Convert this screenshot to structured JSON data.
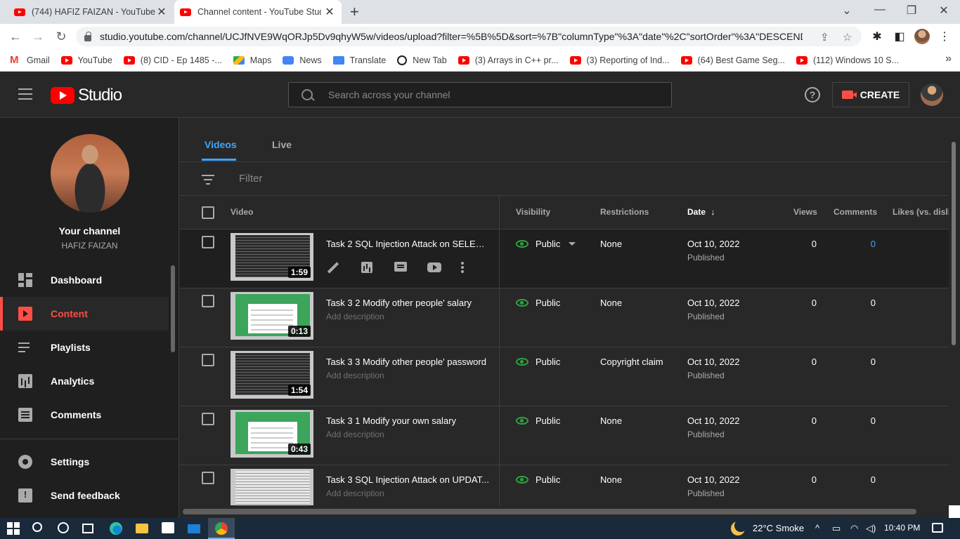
{
  "browser": {
    "tabs": [
      {
        "title": "(744) HAFIZ FAIZAN - YouTube"
      },
      {
        "title": "Channel content - YouTube Studio"
      }
    ],
    "url": "studio.youtube.com/channel/UCJfNVE9WqORJp5Dv9qhyW5w/videos/upload?filter=%5B%5D&sort=%7B\"columnType\"%3A\"date\"%2C\"sortOrder\"%3A\"DESCENDI...",
    "bookmarks": [
      {
        "label": "Gmail",
        "icon": "gmail-icon"
      },
      {
        "label": "YouTube",
        "icon": "youtube-icon"
      },
      {
        "label": "(8) CID - Ep 1485 -...",
        "icon": "youtube-icon"
      },
      {
        "label": "Maps",
        "icon": "maps-icon"
      },
      {
        "label": "News",
        "icon": "news-icon"
      },
      {
        "label": "Translate",
        "icon": "translate-icon"
      },
      {
        "label": "New Tab",
        "icon": "globe-icon"
      },
      {
        "label": "(3) Arrays in C++ pr...",
        "icon": "youtube-icon"
      },
      {
        "label": "(3) Reporting of Ind...",
        "icon": "youtube-icon"
      },
      {
        "label": "(64) Best Game Seg...",
        "icon": "youtube-icon"
      },
      {
        "label": "(112) Windows 10 S...",
        "icon": "youtube-icon"
      }
    ]
  },
  "studio": {
    "logo_text": "Studio",
    "search_placeholder": "Search across your channel",
    "create_label": "CREATE"
  },
  "sidebar": {
    "your_channel": "Your channel",
    "channel_name": "HAFIZ FAIZAN",
    "items": [
      {
        "label": "Dashboard",
        "icon": "dashboard-icon"
      },
      {
        "label": "Content",
        "icon": "content-icon",
        "active": true
      },
      {
        "label": "Playlists",
        "icon": "playlists-icon"
      },
      {
        "label": "Analytics",
        "icon": "analytics-icon"
      },
      {
        "label": "Comments",
        "icon": "comments-icon"
      },
      {
        "label": "Settings",
        "icon": "settings-icon"
      },
      {
        "label": "Send feedback",
        "icon": "feedback-icon"
      }
    ]
  },
  "content": {
    "tabs": [
      {
        "label": "Videos",
        "active": true
      },
      {
        "label": "Live"
      }
    ],
    "filter_placeholder": "Filter",
    "columns": {
      "video": "Video",
      "visibility": "Visibility",
      "restrictions": "Restrictions",
      "date": "Date",
      "views": "Views",
      "comments": "Comments",
      "likes": "Likes (vs. disli"
    },
    "rows": [
      {
        "title": "Task 2 SQL Injection Attack on SELEC...",
        "description": "",
        "duration": "1:59",
        "visibility": "Public",
        "restrictions": "None",
        "date": "Oct 10, 2022",
        "date_sub": "Published",
        "views": "0",
        "comments": "0",
        "thumb": "dark"
      },
      {
        "title": "Task 3 2 Modify other people' salary",
        "description": "Add description",
        "duration": "0:13",
        "visibility": "Public",
        "restrictions": "None",
        "date": "Oct 10, 2022",
        "date_sub": "Published",
        "views": "0",
        "comments": "0",
        "thumb": "green"
      },
      {
        "title": "Task 3 3 Modify other people' password",
        "description": "Add description",
        "duration": "1:54",
        "visibility": "Public",
        "restrictions": "Copyright claim",
        "date": "Oct 10, 2022",
        "date_sub": "Published",
        "views": "0",
        "comments": "0",
        "thumb": "dark"
      },
      {
        "title": "Task 3 1 Modify your own salary",
        "description": "Add description",
        "duration": "0:43",
        "visibility": "Public",
        "restrictions": "None",
        "date": "Oct 10, 2022",
        "date_sub": "Published",
        "views": "0",
        "comments": "0",
        "thumb": "green"
      },
      {
        "title": "Task 3 SQL Injection Attack on UPDAT...",
        "description": "Add description",
        "duration": "",
        "visibility": "Public",
        "restrictions": "None",
        "date": "Oct 10, 2022",
        "date_sub": "Published",
        "views": "0",
        "comments": "0",
        "thumb": "light"
      }
    ]
  },
  "taskbar": {
    "weather": "22°C  Smoke",
    "time": "10:40 PM"
  },
  "colors": {
    "accent_red": "#ff4e45",
    "link_blue": "#3ea6ff",
    "public_green": "#2ba640"
  }
}
